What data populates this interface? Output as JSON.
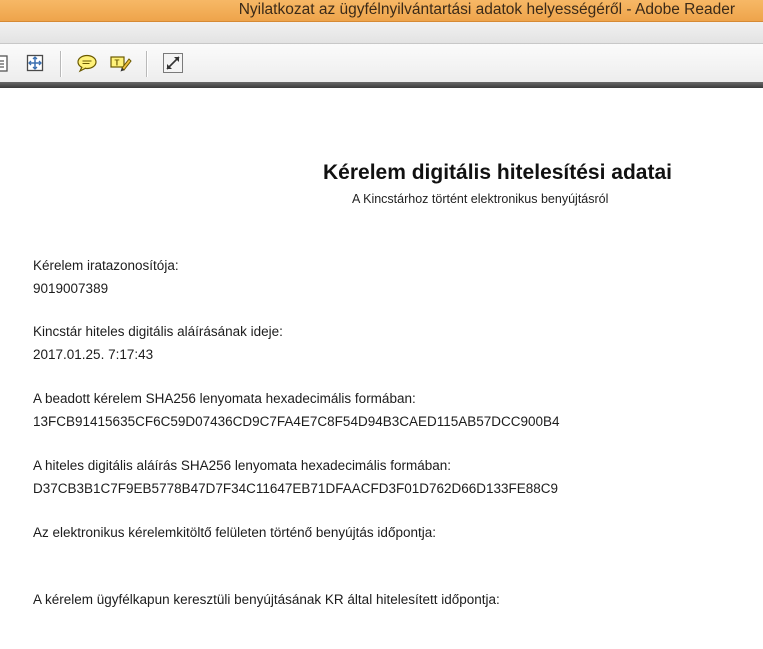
{
  "window": {
    "title": "Nyilatkozat az ügyfélnyilvántartási adatok helyességéről - Adobe Reader"
  },
  "toolbar": {
    "buttons": [
      {
        "icon": "page-icon"
      },
      {
        "icon": "fit-page-icon"
      },
      {
        "icon": "comment-icon"
      },
      {
        "icon": "highlight-text-icon"
      },
      {
        "icon": "full-screen-icon"
      }
    ]
  },
  "document": {
    "title": "Kérelem digitális hitelesítési adatai",
    "subtitle": "A Kincstárhoz történt elektronikus benyújtásról",
    "fields": [
      {
        "label": "Kérelem iratazonosítója:",
        "value": "9019007389"
      },
      {
        "label": "Kincstár hiteles digitális aláírásának ideje:",
        "value": "2017.01.25. 7:17:43"
      },
      {
        "label": "A beadott kérelem SHA256 lenyomata hexadecimális formában:",
        "value": "13FCB91415635CF6C59D07436CD9C7FA4E7C8F54D94B3CAED115AB57DCC900B4"
      },
      {
        "label": "A hiteles digitális aláírás SHA256 lenyomata hexadecimális formában:",
        "value": "D37CB3B1C7F9EB5778B47D7F34C11647EB71DFAACFD3F01D762D66D133FE88C9"
      },
      {
        "label": "Az elektronikus kérelemkitöltő felületen történő benyújtás időpontja:",
        "value": ""
      },
      {
        "label": "A kérelem ügyfélkapun keresztüli benyújtásának KR által hitelesített időpontja:",
        "value": ""
      }
    ]
  }
}
